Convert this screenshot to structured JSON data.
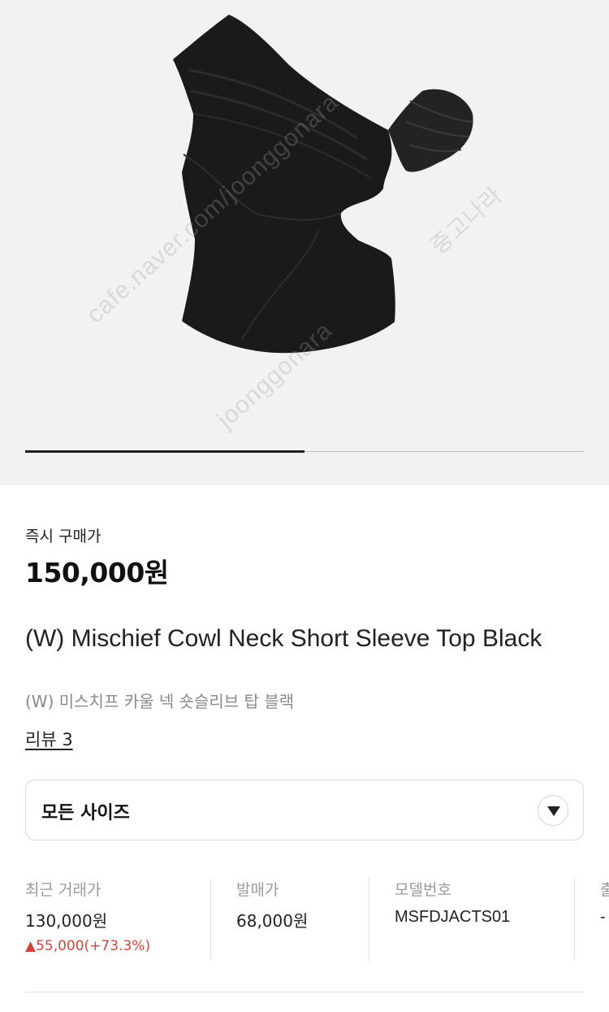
{
  "gallery": {
    "image": "black one-shoulder top with sheer puff sleeve",
    "watermarks": [
      "cafe.naver.com/joonggonara",
      "joonggonara",
      "중고나라"
    ],
    "progress": 0.5
  },
  "pricing": {
    "buy_now_label": "즉시 구매가",
    "buy_now_price": "150,000원"
  },
  "product": {
    "title_en": "(W) Mischief Cowl Neck Short Sleeve Top Black",
    "title_ko": "(W) 미스치프 카울 넥 숏슬리브 탑 블랙",
    "review_link": "리뷰 3"
  },
  "size_select": {
    "selected": "모든 사이즈",
    "icon": "chevron-down-icon"
  },
  "info": {
    "recent_trade_label": "최근 거래가",
    "recent_trade_value": "130,000원",
    "recent_trade_change": "▲55,000(+73.3%)",
    "release_price_label": "발매가",
    "release_price_value": "68,000원",
    "model_no_label": "모델번호",
    "model_no_value": "MSFDJACTS01",
    "release_date_label": "출",
    "release_date_value": "-"
  },
  "colors": {
    "accent_up": "#d0463c",
    "hero_bg": "#f2f2f2",
    "text": "#222222"
  }
}
